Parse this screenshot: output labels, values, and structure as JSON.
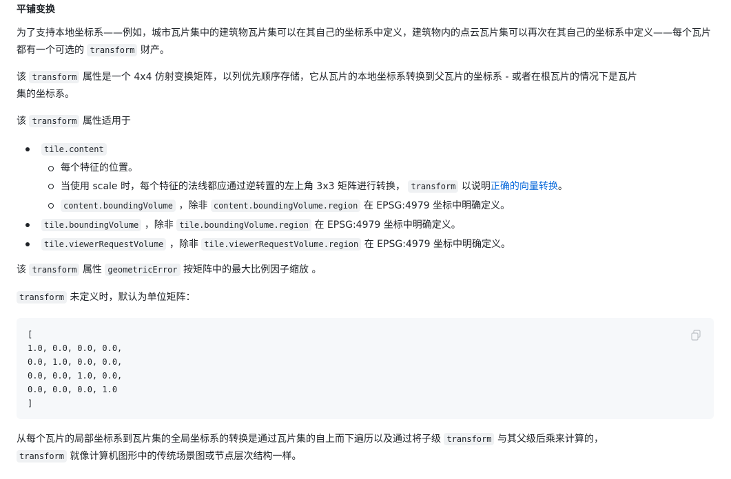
{
  "heading": "平铺变换",
  "p1": {
    "text_a": "为了支持本地坐标系——例如，城市瓦片集中的建筑物瓦片集可以在其自己的坐标系中定义，建筑物内的点云瓦片集可以再次在其自己的坐标系中定义——每个瓦片都有一个可选的",
    "code": "transform",
    "text_b": "财产。"
  },
  "p2": {
    "pre": "该",
    "code": "transform",
    "text_a": "属性是一个 4x4 仿射变换矩阵，以列优先顺序存储，它从瓦片的本地坐标系转换到父瓦片的坐标系 - 或者在根瓦片的情况下是瓦片",
    "text_b": "集的坐标系。"
  },
  "p3": {
    "pre": "该",
    "code": "transform",
    "post": "属性适用于"
  },
  "list": {
    "item1": {
      "code": "tile.content"
    },
    "sub1": {
      "text": "每个特征的位置。"
    },
    "sub2": {
      "text": "当使用 scale 时，每个特征的法线都应通过逆转置的左上角 3x3 矩阵进行转换，",
      "code": "transform",
      "text_b": "以说明",
      "link": "正确的向量转换",
      "end": "。"
    },
    "sub3": {
      "code1": "content.boundingVolume",
      "mid": "，除非",
      "code2": "content.boundingVolume.region",
      "end": "在 EPSG:4979 坐标中明确定义。"
    },
    "item2": {
      "code1": "tile.boundingVolume",
      "mid": "，除非",
      "code2": "tile.boundingVolume.region",
      "end": "在 EPSG:4979 坐标中明确定义。"
    },
    "item3": {
      "code1": "tile.viewerRequestVolume",
      "mid": "，除非",
      "code2": "tile.viewerRequestVolume.region",
      "end": "在 EPSG:4979 坐标中明确定义。"
    }
  },
  "p4": {
    "pre": "该",
    "code1": "transform",
    "mid": "属性",
    "code2": "geometricError",
    "post": "按矩阵中的最大比例因子缩放 。"
  },
  "p5": {
    "code": "transform",
    "post": "未定义时，默认为单位矩阵："
  },
  "codeblock": {
    "text": "[\n1.0, 0.0, 0.0, 0.0,\n0.0, 1.0, 0.0, 0.0,\n0.0, 0.0, 1.0, 0.0,\n0.0, 0.0, 0.0, 1.0\n]"
  },
  "p6": {
    "text_a": "从每个瓦片的局部坐标系到瓦片集的全局坐标系的转换是通过瓦片集的自上而下遍历以及通过将子级",
    "code1": "transform",
    "text_b": "与其父级后乘来计算的，",
    "code2": "transform",
    "text_c": "就像计算机图形中的传统场景图或节点层次结构一样。"
  }
}
